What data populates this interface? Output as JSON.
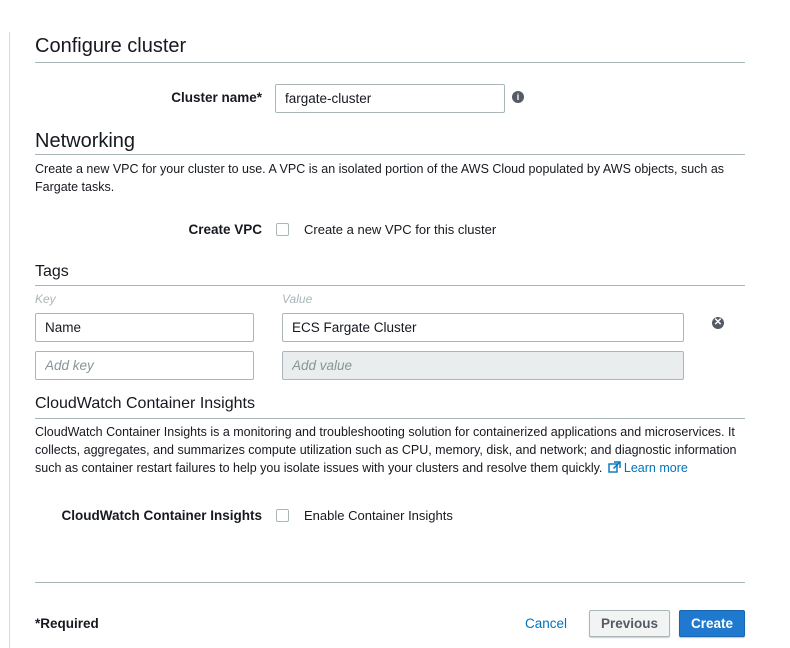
{
  "configure_cluster": {
    "title": "Configure cluster",
    "cluster_name_label": "Cluster name*",
    "cluster_name_value": "fargate-cluster",
    "info_icon": "info-icon"
  },
  "networking": {
    "title": "Networking",
    "description": "Create a new VPC for your cluster to use. A VPC is an isolated portion of the AWS Cloud populated by AWS objects, such as Fargate tasks.",
    "create_vpc_label": "Create VPC",
    "create_vpc_checkbox_label": "Create a new VPC for this cluster"
  },
  "tags": {
    "title": "Tags",
    "key_header": "Key",
    "value_header": "Value",
    "rows": [
      {
        "key": "Name",
        "value": "ECS Fargate Cluster"
      }
    ],
    "add_key_placeholder": "Add key",
    "add_value_placeholder": "Add value",
    "remove_icon": "remove-circle-icon"
  },
  "cloudwatch": {
    "title": "CloudWatch Container Insights",
    "description": "CloudWatch Container Insights is a monitoring and troubleshooting solution for containerized applications and microservices. It collects, aggregates, and summarizes compute utilization such as CPU, memory, disk, and network; and diagnostic information such as container restart failures to help you isolate issues with your clusters and resolve them quickly.",
    "learn_more": "Learn more",
    "external_link_icon": "external-link-icon",
    "field_label": "CloudWatch Container Insights",
    "checkbox_label": "Enable Container Insights"
  },
  "footer": {
    "required_note": "*Required",
    "cancel": "Cancel",
    "previous": "Previous",
    "create": "Create"
  }
}
